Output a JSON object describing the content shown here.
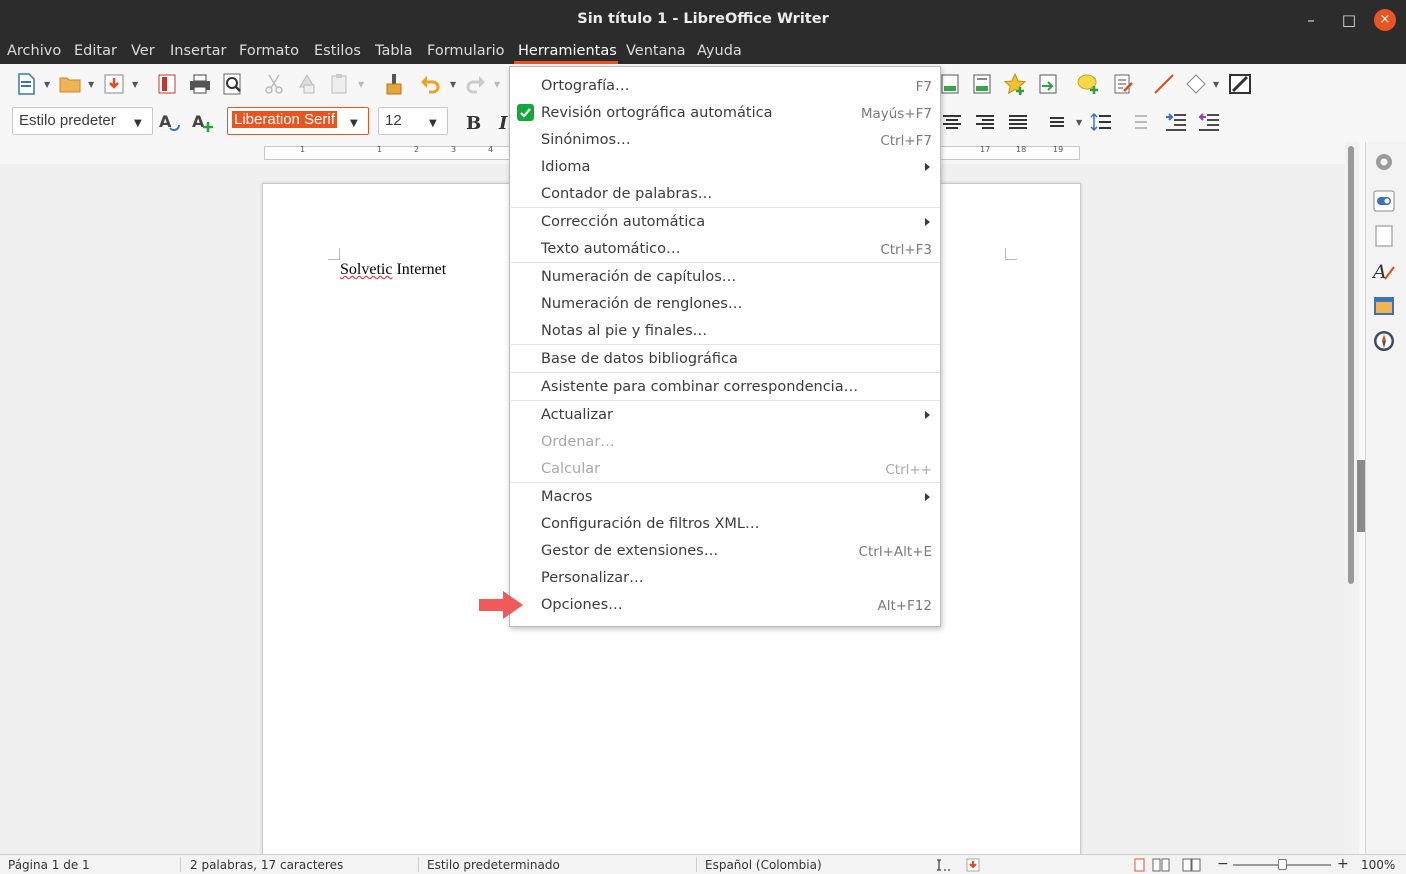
{
  "window": {
    "title": "Sin título 1 - LibreOffice Writer",
    "controls": {
      "minimize": "–",
      "maximize": "□",
      "close": "×"
    },
    "doc_close": "×"
  },
  "menubar": {
    "items": [
      "Archivo",
      "Editar",
      "Ver",
      "Insertar",
      "Formato",
      "Estilos",
      "Tabla",
      "Formulario",
      "Herramientas",
      "Ventana",
      "Ayuda"
    ],
    "active": "Herramientas"
  },
  "formatting": {
    "paragraph_style": "Estilo predeter",
    "font_name": "Liberation Serif",
    "font_size": "12"
  },
  "ruler": {
    "labels": [
      "1",
      "1",
      "2",
      "3",
      "4",
      "17",
      "18",
      "19"
    ]
  },
  "document": {
    "text_word1": "Solvetic",
    "text_word2": " Internet"
  },
  "tools_menu": {
    "items": [
      {
        "label": "Ortografía…",
        "shortcut": "F7"
      },
      {
        "label": "Revisión ortográfica automática",
        "shortcut": "Mayús+F7",
        "checked": true
      },
      {
        "label": "Sinónimos…",
        "shortcut": "Ctrl+F7"
      },
      {
        "label": "Idioma",
        "shortcut": "",
        "submenu": true
      },
      {
        "label": "Contador de palabras…",
        "shortcut": ""
      },
      {
        "label": "Corrección automática",
        "shortcut": "",
        "submenu": true
      },
      {
        "label": "Texto automático…",
        "shortcut": "Ctrl+F3"
      },
      {
        "label": "Numeración de capítulos…",
        "shortcut": ""
      },
      {
        "label": "Numeración de renglones…",
        "shortcut": ""
      },
      {
        "label": "Notas al pie y finales…",
        "shortcut": ""
      },
      {
        "label": "Base de datos bibliográfica",
        "shortcut": ""
      },
      {
        "label": "Asistente para combinar correspondencia…",
        "shortcut": ""
      },
      {
        "label": "Actualizar",
        "shortcut": "",
        "submenu": true
      },
      {
        "label": "Ordenar…",
        "shortcut": "",
        "disabled": true
      },
      {
        "label": "Calcular",
        "shortcut": "Ctrl++",
        "disabled": true
      },
      {
        "label": "Macros",
        "shortcut": "",
        "submenu": true
      },
      {
        "label": "Configuración de filtros XML…",
        "shortcut": ""
      },
      {
        "label": "Gestor de extensiones…",
        "shortcut": "Ctrl+Alt+E"
      },
      {
        "label": "Personalizar…",
        "shortcut": ""
      },
      {
        "label": "Opciones…",
        "shortcut": "Alt+F12"
      }
    ]
  },
  "statusbar": {
    "page": "Página 1 de 1",
    "words": "2 palabras, 17 caracteres",
    "style": "Estilo predeterminado",
    "language": "Español (Colombia)",
    "zoom": "100%"
  },
  "colors": {
    "accent": "#e95420",
    "titlebar": "#2c2c2c",
    "check": "#11a83d",
    "annotation_arrow": "#f05a5a"
  },
  "icons": [
    "new-document-icon",
    "open-folder-icon",
    "save-icon",
    "export-pdf-icon",
    "print-icon",
    "print-preview-icon",
    "cut-icon",
    "copy-icon",
    "paste-icon",
    "clone-formatting-icon",
    "undo-icon",
    "redo-icon",
    "insert-image-icon",
    "insert-chart-icon",
    "special-character-icon",
    "insert-field-icon",
    "comment-icon",
    "track-changes-icon",
    "line-icon",
    "basic-shapes-icon",
    "draw-icon",
    "update-style-icon",
    "new-style-icon",
    "bold-icon",
    "italic-icon",
    "align-center-icon",
    "align-right-icon",
    "justify-icon",
    "line-spacing-icon",
    "paragraph-spacing-icon",
    "indent-increase-icon",
    "indent-decrease-icon",
    "properties-icon",
    "page-icon",
    "styles-icon",
    "gallery-icon",
    "navigator-icon"
  ]
}
